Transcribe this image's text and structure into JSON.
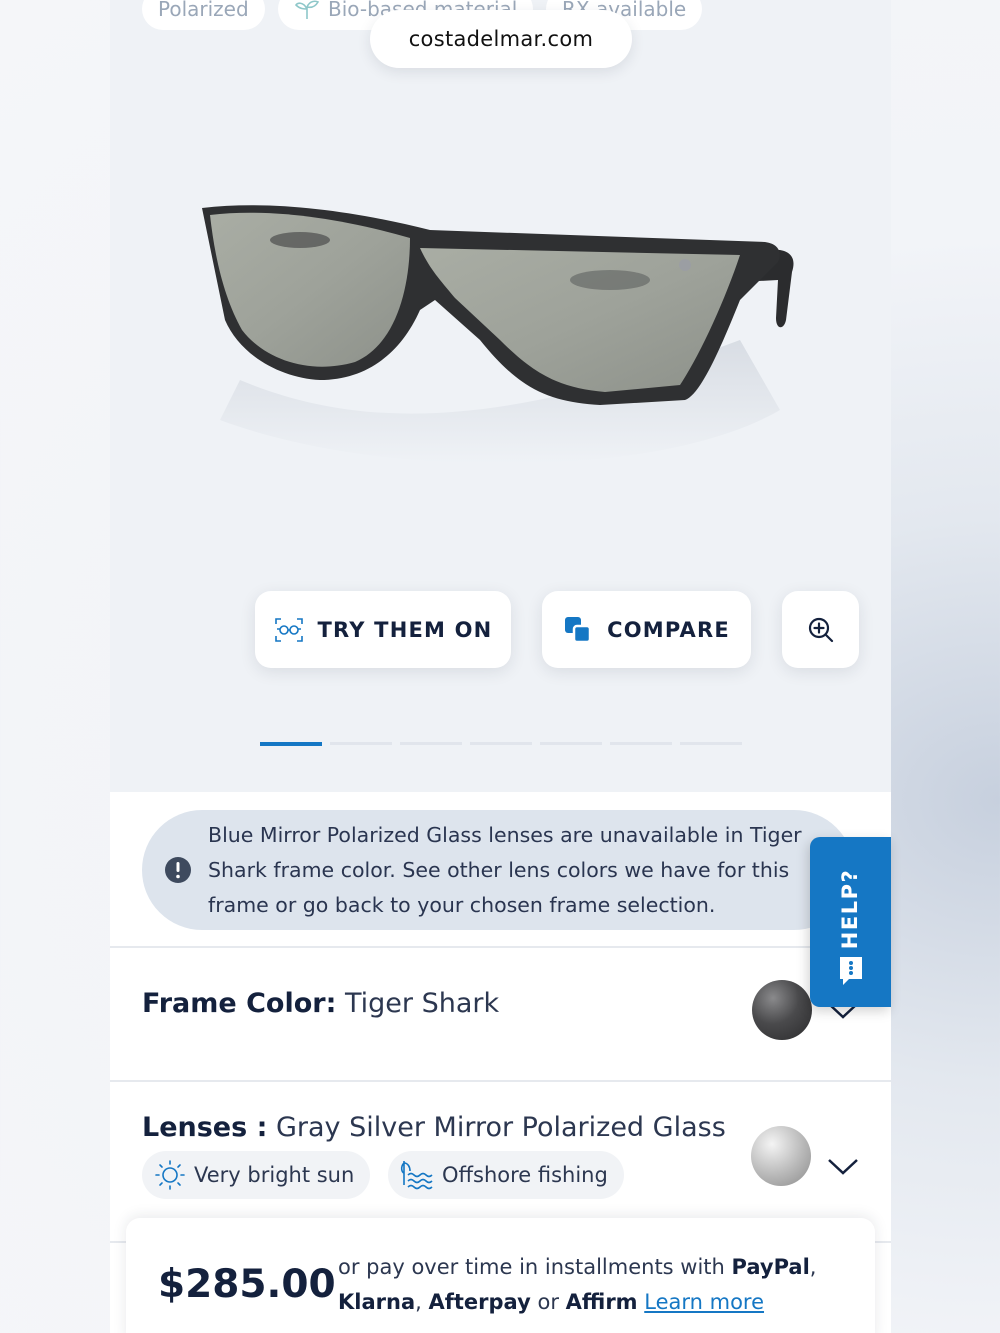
{
  "browser": {
    "url": "costadelmar.com"
  },
  "feature_chips": [
    "Polarized",
    "Bio-based material",
    "RX available"
  ],
  "actions": {
    "try_on_label": "TRY THEM ON",
    "compare_label": "COMPARE"
  },
  "carousel": {
    "total": 7,
    "active_index": 0
  },
  "notice": {
    "text": "Blue Mirror Polarized Glass lenses are unavailable in Tiger Shark frame color. See other lens colors we have for this frame or go back to your chosen frame selection."
  },
  "help": {
    "label": "HELP?"
  },
  "frame_color": {
    "label": "Frame Color:",
    "value": "Tiger Shark",
    "swatch_color": "#4a4a4c"
  },
  "lenses": {
    "label": "Lenses :",
    "value": "Gray Silver Mirror Polarized Glass",
    "swatch_color": "#b8b8b8",
    "tags": [
      "Very bright sun",
      "Offshore fishing"
    ]
  },
  "pricing": {
    "price": "$285.00",
    "text_1": "or pay over time in installments with",
    "paypal": "PayPal",
    "comma": ",",
    "klarna": "Klarna",
    "afterpay": "Afterpay",
    "or": "or",
    "affirm": "Affirm",
    "learn_more": "Learn more"
  },
  "colors": {
    "accent": "#1577c4",
    "text_dark": "#14213d"
  }
}
